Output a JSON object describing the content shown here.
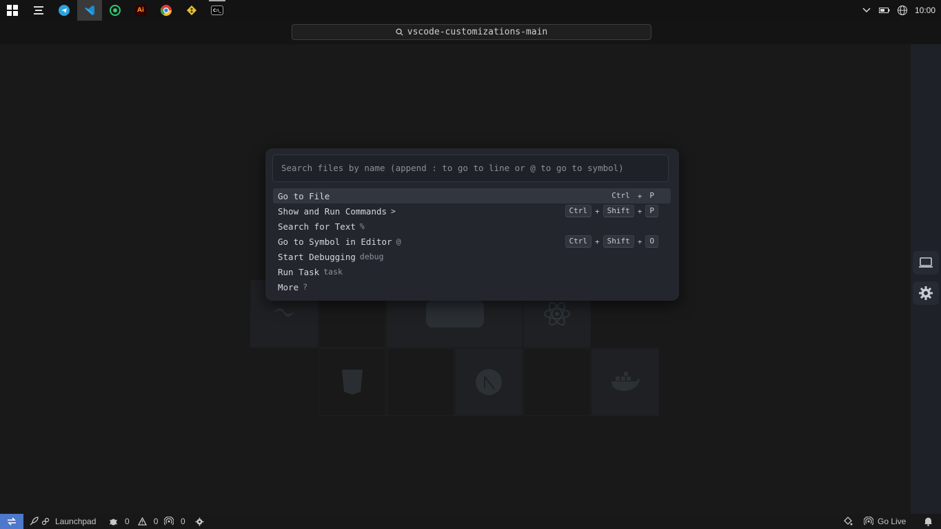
{
  "taskbar": {
    "apps": [
      {
        "name": "windows-start-icon",
        "label": ""
      },
      {
        "name": "cursor-app-icon",
        "label": ""
      },
      {
        "name": "telegram-app-icon",
        "label": ""
      },
      {
        "name": "vscode-app-icon",
        "label": "",
        "active": true
      },
      {
        "name": "whatsapp-app-icon",
        "label": ""
      },
      {
        "name": "adobe-illustrator-app-icon",
        "label": "Ai"
      },
      {
        "name": "chrome-app-icon",
        "label": ""
      },
      {
        "name": "git-app-icon",
        "label": ""
      },
      {
        "name": "terminal-app-icon",
        "label": "C:\\_"
      }
    ],
    "clock": "10:00"
  },
  "title": {
    "search_text": "vscode-customizations-main"
  },
  "quickpick": {
    "placeholder": "Search files by name (append : to go to line or @ to go to symbol)",
    "items": [
      {
        "label": "Go to File",
        "hint": "",
        "keys": [
          "Ctrl",
          "P"
        ]
      },
      {
        "label": "Show and Run Commands",
        "hint": ">",
        "keys": [
          "Ctrl",
          "Shift",
          "P"
        ]
      },
      {
        "label": "Search for Text",
        "hint": "%",
        "keys": []
      },
      {
        "label": "Go to Symbol in Editor",
        "hint": "@",
        "keys": [
          "Ctrl",
          "Shift",
          "O"
        ]
      },
      {
        "label": "Start Debugging",
        "hint": "debug",
        "keys": []
      },
      {
        "label": "Run Task",
        "hint": "task",
        "keys": []
      },
      {
        "label": "More",
        "hint": "?",
        "keys": []
      }
    ],
    "plus": "+"
  },
  "statusbar": {
    "launchpad": "Launchpad",
    "errors": "0",
    "warnings": "0",
    "ports": "0",
    "go_live": "Go Live"
  },
  "colors": {
    "accent": "#4d78cc",
    "panel_bg": "#23262d",
    "editor_bg": "#191919"
  }
}
